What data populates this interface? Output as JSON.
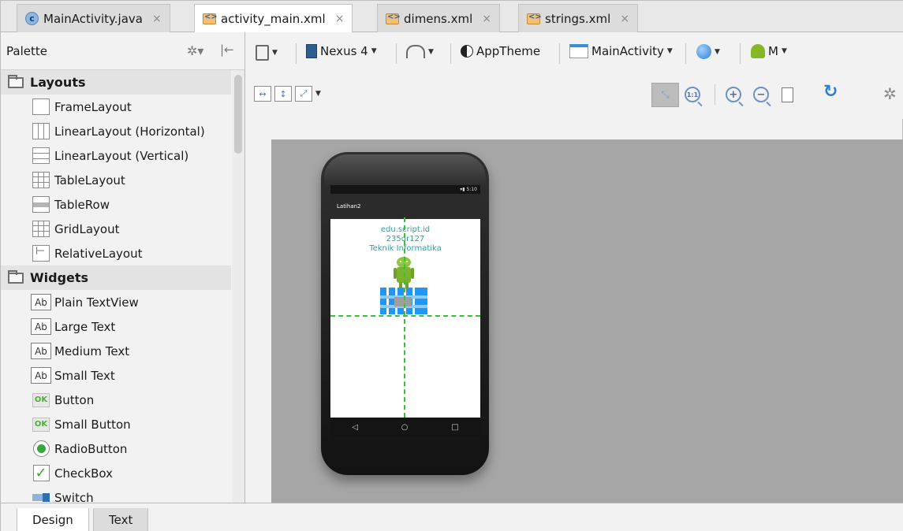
{
  "tabs": [
    {
      "label": "MainActivity.java",
      "icon": "java-class-icon",
      "active": false
    },
    {
      "label": "activity_main.xml",
      "icon": "xml-file-icon",
      "active": true
    },
    {
      "label": "dimens.xml",
      "icon": "xml-file-icon",
      "active": false
    },
    {
      "label": "strings.xml",
      "icon": "xml-file-icon",
      "active": false
    }
  ],
  "tab_close_glyph": "×",
  "palette": {
    "title": "Palette",
    "groups": [
      {
        "label": "Layouts",
        "items": [
          "FrameLayout",
          "LinearLayout (Horizontal)",
          "LinearLayout (Vertical)",
          "TableLayout",
          "TableRow",
          "GridLayout",
          "RelativeLayout"
        ]
      },
      {
        "label": "Widgets",
        "items": [
          "Plain TextView",
          "Large Text",
          "Medium Text",
          "Small Text",
          "Button",
          "Small Button",
          "RadioButton",
          "CheckBox",
          "Switch"
        ]
      }
    ],
    "ab_glyph": "Ab",
    "ok_glyph": "OK"
  },
  "toolbar": {
    "device": "Nexus 4",
    "theme": "AppTheme",
    "activity": "MainActivity",
    "api": "M"
  },
  "preview": {
    "status_time": "5:10",
    "app_title": "Latihan2",
    "lines": [
      "edu.script.id",
      "235dr127",
      "Teknik Informatika"
    ]
  },
  "bottom_tabs": [
    "Design",
    "Text"
  ],
  "colors": {
    "accent_text": "#27a3a3",
    "guide": "#36c436",
    "canvas": "#a6a6a6",
    "widget_blue": "#2196f3"
  }
}
